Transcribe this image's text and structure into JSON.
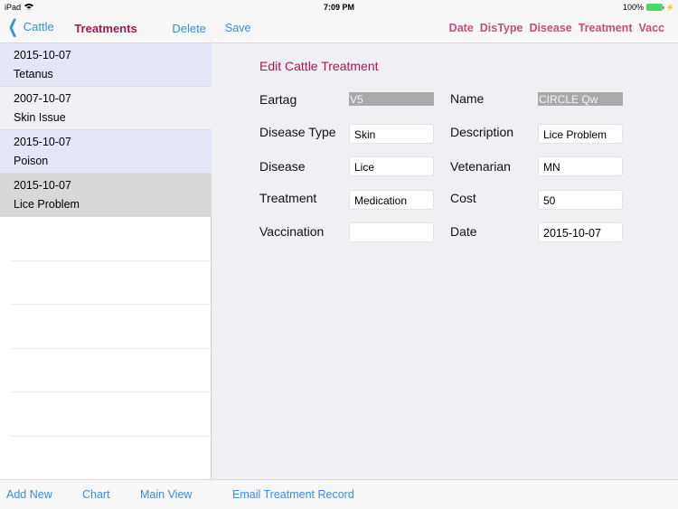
{
  "status_bar": {
    "device": "iPad",
    "time": "7:09 PM",
    "battery": "100%"
  },
  "master": {
    "back_label": "Cattle",
    "title": "Treatments",
    "right_button": "Delete",
    "rows": [
      {
        "date": "2015-10-07",
        "title": "Tetanus"
      },
      {
        "date": "2007-10-07",
        "title": "Skin Issue"
      },
      {
        "date": "2015-10-07",
        "title": "Poison"
      },
      {
        "date": "2015-10-07",
        "title": "Lice Problem"
      }
    ],
    "selected_index": 3,
    "toolbar": {
      "add_new": "Add New",
      "chart": "Chart",
      "main_view": "Main View"
    }
  },
  "detail": {
    "save_label": "Save",
    "sort_buttons": [
      "Date",
      "DisType",
      "Disease",
      "Treatment",
      "Vacc"
    ],
    "form_title": "Edit Cattle Treatment",
    "fields": {
      "eartag": {
        "label": "Eartag",
        "value": "V5"
      },
      "name": {
        "label": "Name",
        "value": "CIRCLE Qw"
      },
      "disease_type": {
        "label": "Disease Type",
        "value": "Skin"
      },
      "description": {
        "label": "Description",
        "value": "Lice Problem"
      },
      "disease": {
        "label": "Disease",
        "value": "Lice"
      },
      "vetenarian": {
        "label": "Vetenarian",
        "value": "MN"
      },
      "treatment": {
        "label": "Treatment",
        "value": "Medication"
      },
      "cost": {
        "label": "Cost",
        "value": "50"
      },
      "vaccination": {
        "label": "Vaccination",
        "value": ""
      },
      "date": {
        "label": "Date",
        "value": "2015-10-07"
      }
    },
    "toolbar": {
      "email": "Email Treatment Record"
    }
  }
}
